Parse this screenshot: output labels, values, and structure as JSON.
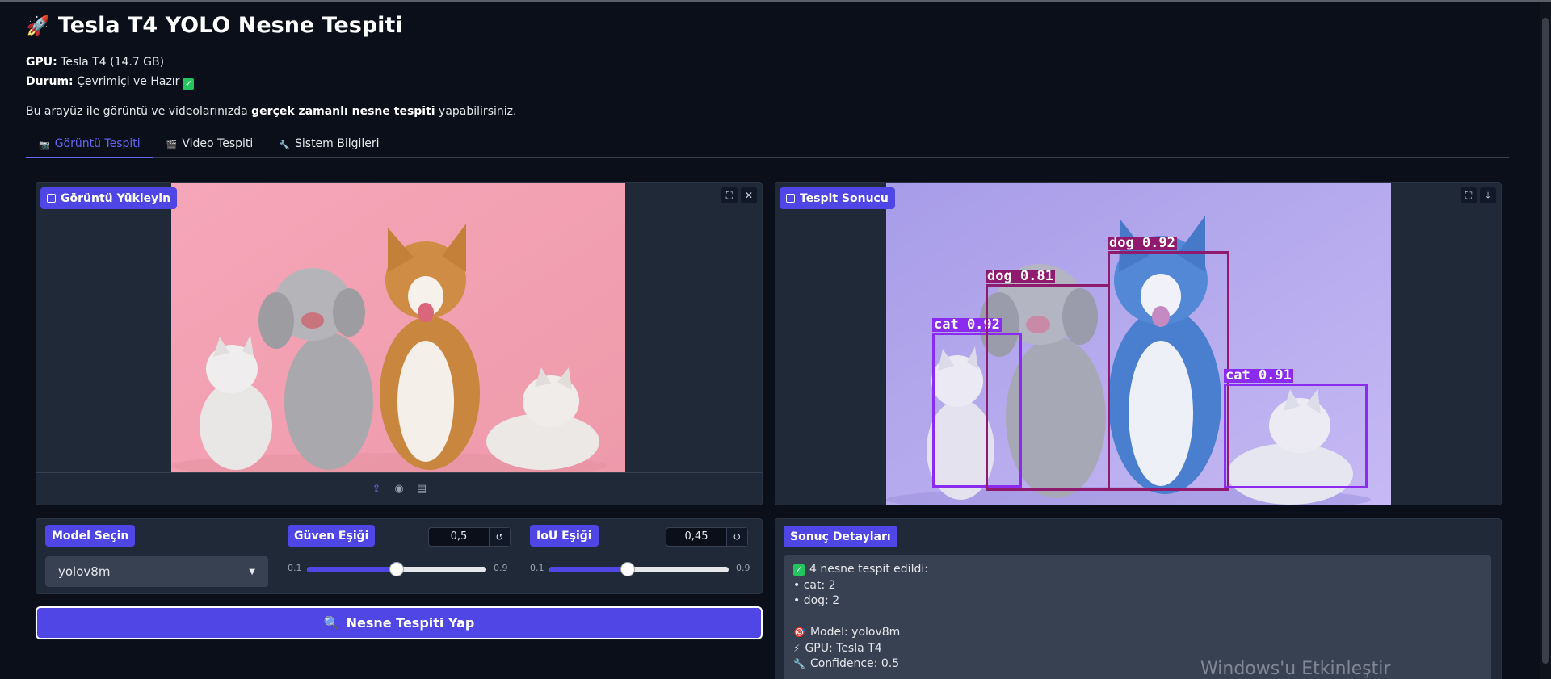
{
  "page": {
    "title_icon": "rocket-icon",
    "title": "Tesla T4 YOLO Nesne Tespiti",
    "gpu_label": "GPU:",
    "gpu_value": "Tesla T4 (14.7 GB)",
    "status_label": "Durum:",
    "status_value": "Çevrimiçi ve Hazır",
    "intro_before": "Bu arayüz ile görüntü ve videolarınızda",
    "intro_bold": "gerçek zamanlı nesne tespiti",
    "intro_after": "yapabilirsiniz."
  },
  "tabs": [
    {
      "label": "Görüntü Tespiti",
      "icon": "camera-icon",
      "active": true
    },
    {
      "label": "Video Tespiti",
      "icon": "clapper-icon",
      "active": false
    },
    {
      "label": "Sistem Bilgileri",
      "icon": "wrench-icon",
      "active": false
    }
  ],
  "upload_panel": {
    "label": "Görüntü Yükleyin",
    "actions": [
      "upload-icon",
      "webcam-icon",
      "clipboard-icon"
    ]
  },
  "result_panel": {
    "label": "Tespit Sonucu",
    "detections": [
      {
        "label": "cat 0.92",
        "color": "#8b2bf0"
      },
      {
        "label": "dog 0.81",
        "color": "#8f1a6e"
      },
      {
        "label": "dog 0.92",
        "color": "#8f1a6e"
      },
      {
        "label": "cat 0.91",
        "color": "#8b2bf0"
      }
    ]
  },
  "controls": {
    "model_label": "Model Seçin",
    "model_value": "yolov8m",
    "conf_label": "Güven Eşiği",
    "conf_value": "0,5",
    "conf_min": "0.1",
    "conf_max": "0.9",
    "conf_fraction": 0.5,
    "iou_label": "IoU Eşiği",
    "iou_value": "0,45",
    "iou_min": "0.1",
    "iou_max": "0.9",
    "iou_fraction": 0.4375
  },
  "run_button": {
    "icon": "magnifier-icon",
    "label": "Nesne Tespiti Yap"
  },
  "details": {
    "label": "Sonuç Detayları",
    "summary": "4 nesne tespit edildi:",
    "cat_line": "• cat: 2",
    "dog_line": "• dog: 2",
    "model_line": "Model: yolov8m",
    "gpu_line": "GPU: Tesla T4",
    "confidence_line": "Confidence: 0.5"
  },
  "watermark": "Windows'u Etkinleştir",
  "colors": {
    "accent": "#4f46e5",
    "background": "#0b0f19",
    "panel": "#1f2937"
  }
}
